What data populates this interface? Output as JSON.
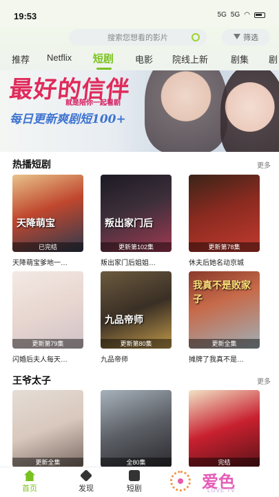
{
  "status": {
    "time": "19:53",
    "net": "5G",
    "net2": "5G"
  },
  "search": {
    "placeholder": "搜索您想看的影片",
    "filter_label": "筛选"
  },
  "tabs": [
    {
      "label": "推荐"
    },
    {
      "label": "Netflix"
    },
    {
      "label": "短剧"
    },
    {
      "label": "电影"
    },
    {
      "label": "院线上新"
    },
    {
      "label": "剧集"
    },
    {
      "label": "剧"
    }
  ],
  "active_tab": "短剧",
  "banner": {
    "title": "最好的信伴",
    "subtitle": "就是陪你一起看剧",
    "slogan": "每日更新爽剧短100+"
  },
  "sections": [
    {
      "title": "热播短剧",
      "more": "更多",
      "items": [
        {
          "title": "天降萌宝爹地一…",
          "badge": "已完结",
          "poster_text": "天降萌宝"
        },
        {
          "title": "叛出家门后姐姐…",
          "badge": "更新第102集",
          "poster_text": "叛出家门后"
        },
        {
          "title": "休夫后她名动京城",
          "badge": "更新第78集",
          "poster_text": ""
        },
        {
          "title": "闪婚后夫人每天…",
          "badge": "更新第79集",
          "poster_text": ""
        },
        {
          "title": "九品帝师",
          "badge": "更新第80集",
          "poster_text": "九品帝师"
        },
        {
          "title": "摊牌了我真不是…",
          "badge": "更新全集",
          "poster_text": "我真不是败家子"
        }
      ]
    },
    {
      "title": "王爷太子",
      "more": "更多",
      "items": [
        {
          "badge": "更新全集"
        },
        {
          "badge": "全80集"
        },
        {
          "badge": "完结"
        }
      ]
    }
  ],
  "bottom_nav": [
    {
      "label": "首页",
      "icon": "home-icon"
    },
    {
      "label": "发现",
      "icon": "discover-icon"
    },
    {
      "label": "短剧",
      "icon": "short-drama-icon"
    }
  ],
  "watermark": {
    "text": "爱色",
    "sub": "LOVE TV"
  },
  "colors": {
    "accent": "#7ac21f",
    "banner_title": "#e02a5b",
    "banner_slogan": "#3f74d1"
  }
}
